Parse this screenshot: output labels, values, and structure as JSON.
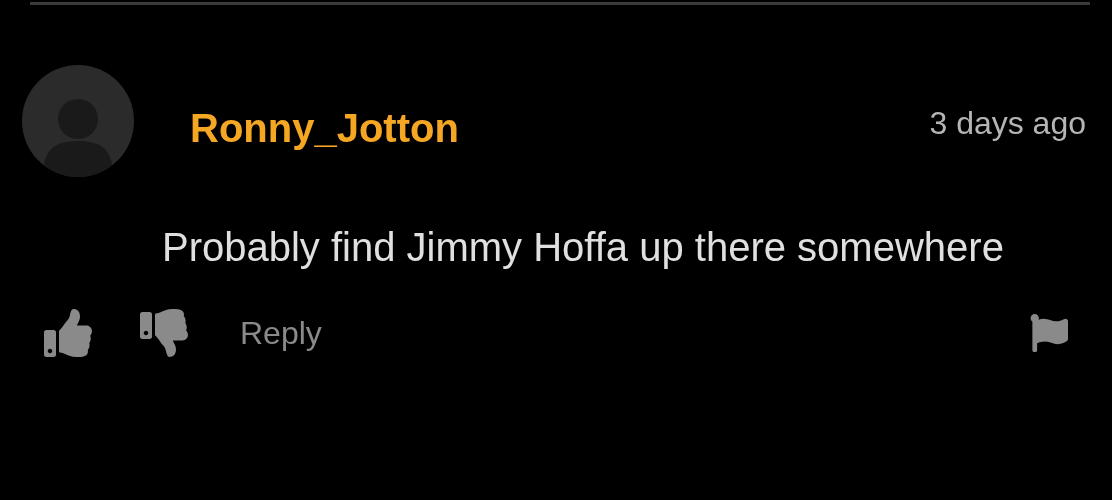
{
  "comment": {
    "author": "Ronny_Jotton",
    "time": "3 days ago",
    "text": "Probably find Jimmy Hoffa up there somewhere"
  },
  "actions": {
    "reply": "Reply"
  }
}
